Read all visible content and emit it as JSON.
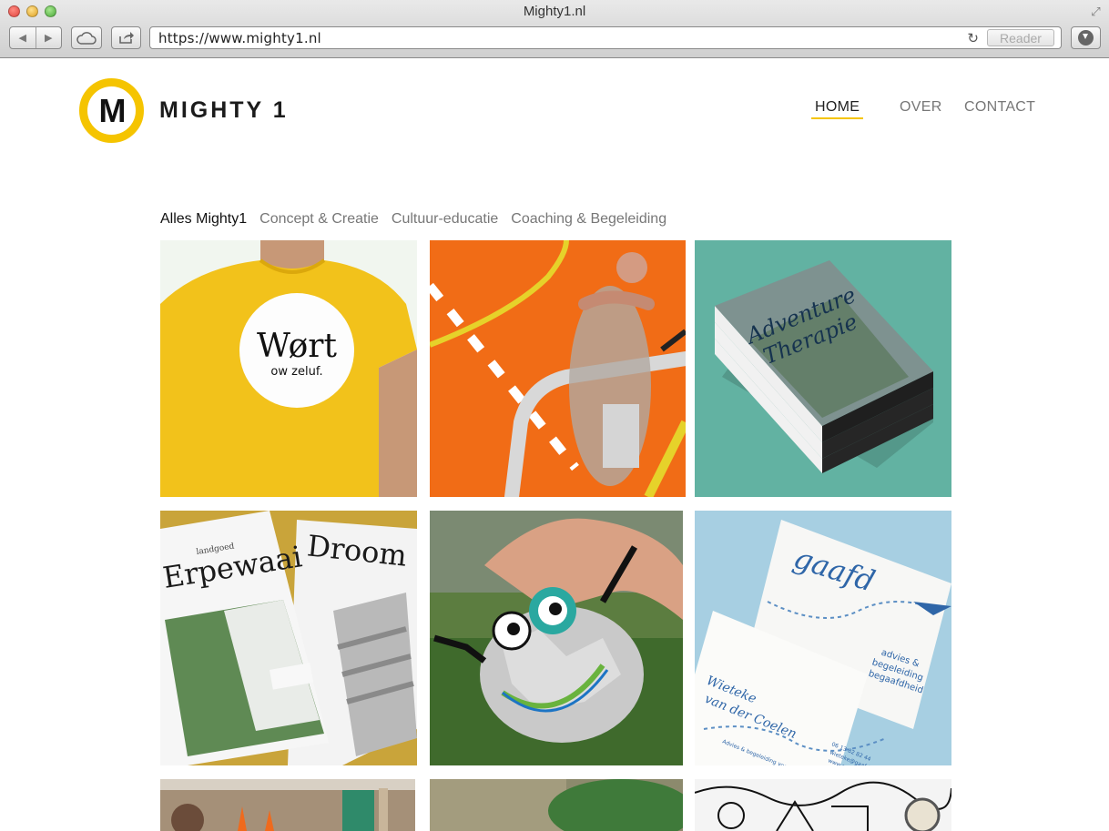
{
  "browser": {
    "window_title": "Mighty1.nl",
    "url": "https://www.mighty1.nl",
    "reader_label": "Reader"
  },
  "site": {
    "logo_letter": "M",
    "logo_text": "MIGHTY 1",
    "brand_color": "#f5c400",
    "nav": {
      "home": "HOME",
      "over": "OVER",
      "contact": "CONTACT"
    },
    "filters": {
      "all": "Alles Mighty1",
      "concept": "Concept & Creatie",
      "cultuur": "Cultuur-educatie",
      "coaching": "Coaching & Begeleiding"
    }
  },
  "portfolio": {
    "tshirt": {
      "brand": "Wørt",
      "tagline": "ow zeluf."
    },
    "book": {
      "title_line1": "Adventure",
      "title_line2": "Therapie"
    },
    "magazine": {
      "small_label": "landgoed",
      "title": "Erpewaai",
      "right_title": "Droom"
    },
    "cards": {
      "logo": "gaafd",
      "tagline_1": "advies &",
      "tagline_2": "begeleiding",
      "tagline_3": "begaafdheid",
      "name_1": "Wieteke",
      "name_2": "van der Coelen",
      "phone": "06 13 82 82 44",
      "email": "wieteke@gaafd.nl",
      "web": "www.gaafd.nl",
      "footer": "Advies & begeleiding voor leerkrachten"
    }
  }
}
